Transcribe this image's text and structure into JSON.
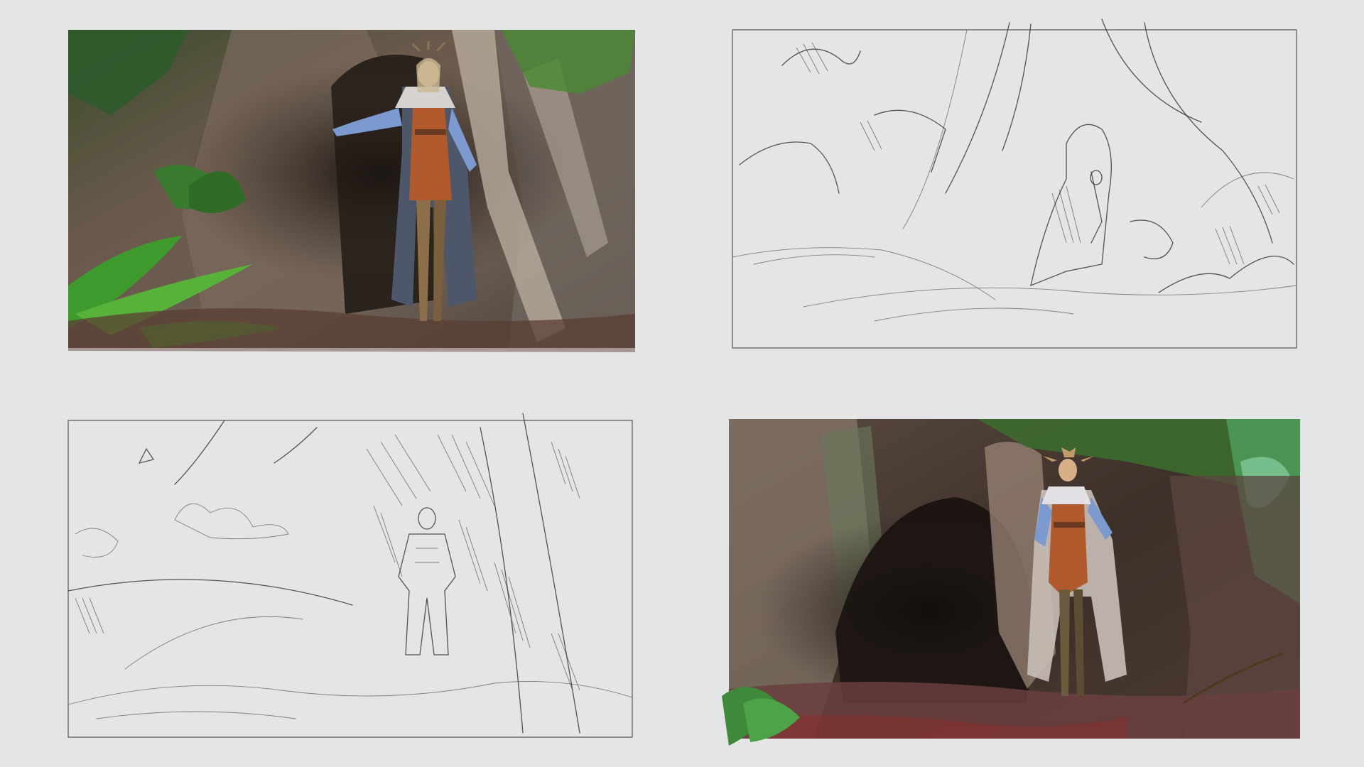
{
  "panels": [
    {
      "id": "colored-sketch-1",
      "kind": "colored illustration"
    },
    {
      "id": "pencil-sketch-1",
      "kind": "line sketch"
    },
    {
      "id": "pencil-sketch-2",
      "kind": "line sketch"
    },
    {
      "id": "colored-sketch-2",
      "kind": "colored illustration"
    }
  ],
  "colors": {
    "background": "#e4e5e7",
    "foliage": "#3f8a2e",
    "rock": "#6b5a4d",
    "cave": "#2a211c",
    "coat": "#5d6a86",
    "tunic": "#b5582a",
    "sleeve": "#7a9ad0"
  }
}
